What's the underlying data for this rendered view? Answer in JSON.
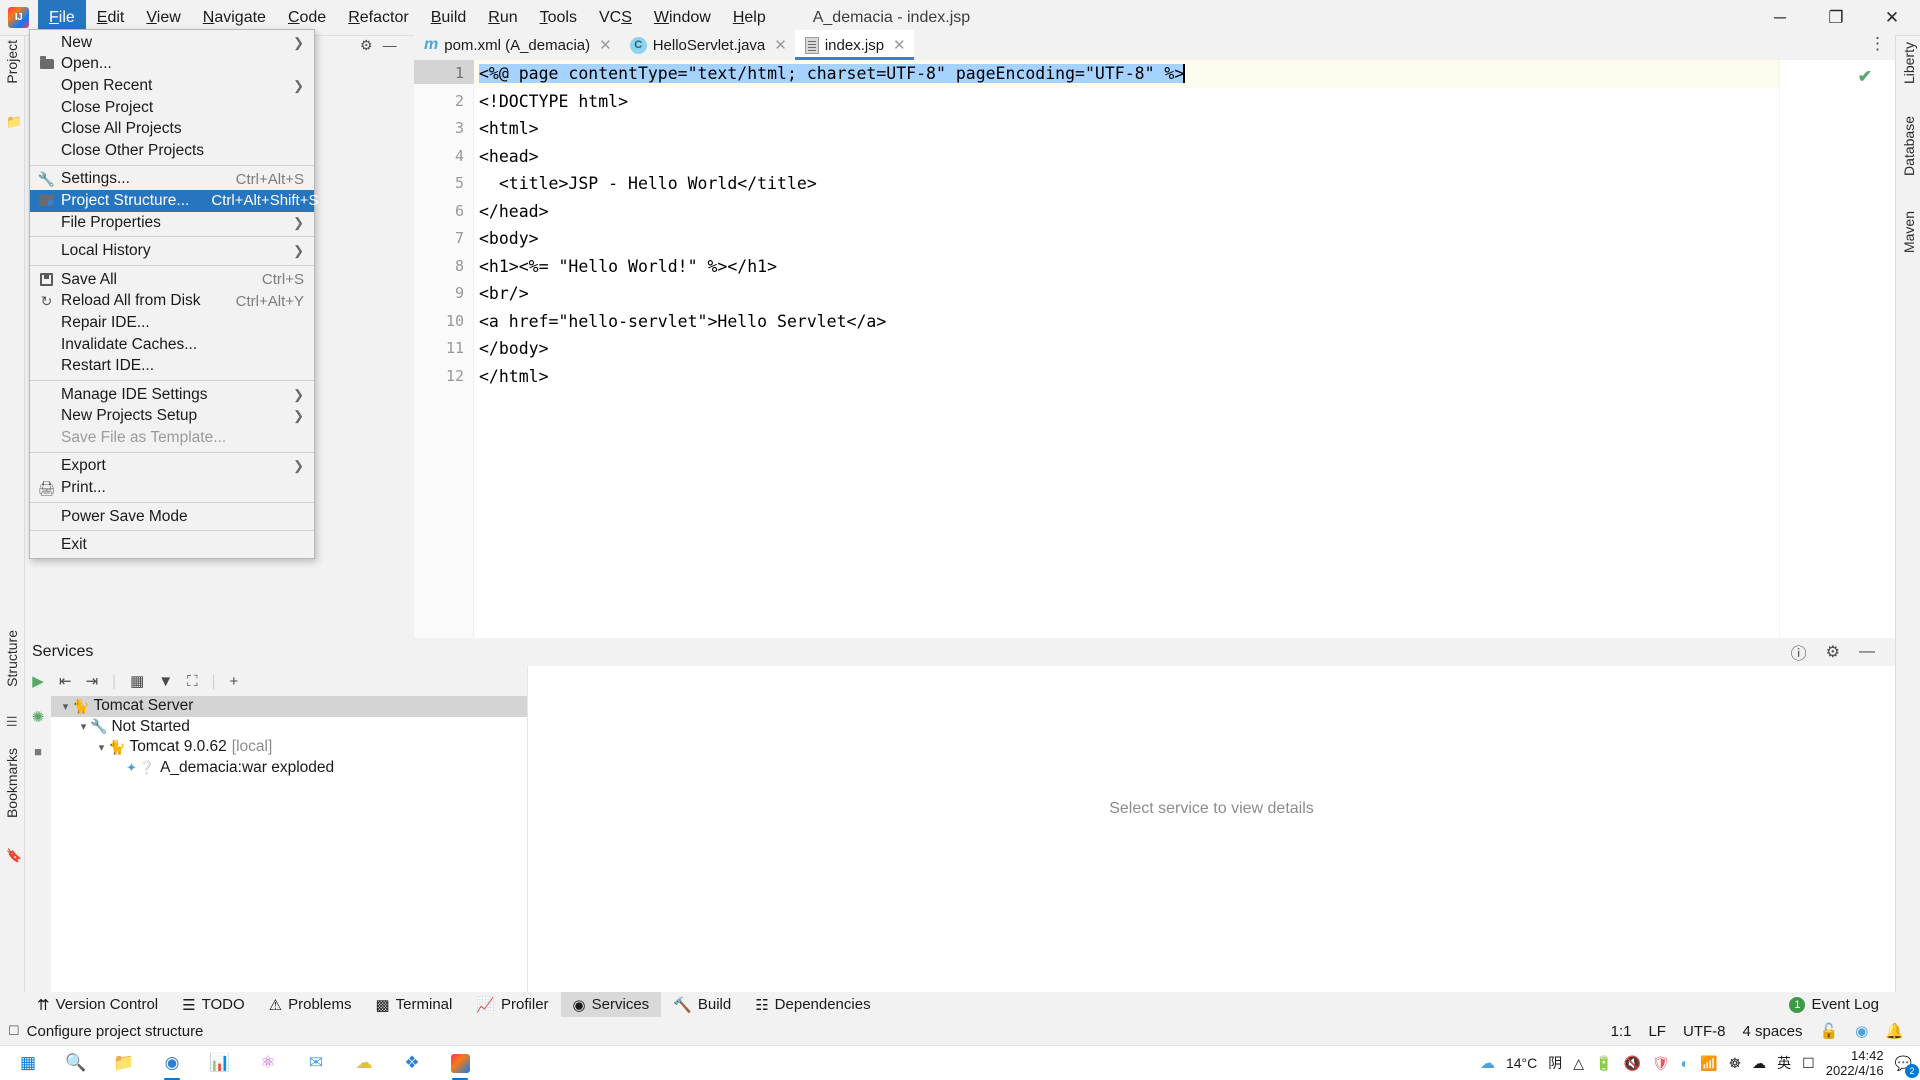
{
  "window": {
    "title": "A_demacia - index.jsp",
    "minimize": "─",
    "maximize": "❐",
    "close": "✕"
  },
  "menubar": [
    {
      "label": "File",
      "mnemonic": "F",
      "active": true
    },
    {
      "label": "Edit",
      "mnemonic": "E",
      "active": false
    },
    {
      "label": "View",
      "mnemonic": "V",
      "active": false
    },
    {
      "label": "Navigate",
      "mnemonic": "N",
      "active": false
    },
    {
      "label": "Code",
      "mnemonic": "C",
      "active": false
    },
    {
      "label": "Refactor",
      "mnemonic": "R",
      "active": false
    },
    {
      "label": "Build",
      "mnemonic": "B",
      "active": false
    },
    {
      "label": "Run",
      "mnemonic": "R",
      "active": false
    },
    {
      "label": "Tools",
      "mnemonic": "T",
      "active": false
    },
    {
      "label": "VCS",
      "mnemonic": "S",
      "active": false
    },
    {
      "label": "Window",
      "mnemonic": "W",
      "active": false
    },
    {
      "label": "Help",
      "mnemonic": "H",
      "active": false
    }
  ],
  "file_menu": {
    "items": [
      {
        "label": "New",
        "shortcut": "",
        "icon": "",
        "submenu": true,
        "selected": false,
        "disabled": false,
        "separator_after": false
      },
      {
        "label": "Open...",
        "shortcut": "",
        "icon": "folder-icon",
        "submenu": false,
        "selected": false,
        "disabled": false,
        "separator_after": false
      },
      {
        "label": "Open Recent",
        "shortcut": "",
        "icon": "",
        "submenu": true,
        "selected": false,
        "disabled": false,
        "separator_after": false
      },
      {
        "label": "Close Project",
        "shortcut": "",
        "icon": "",
        "submenu": false,
        "selected": false,
        "disabled": false,
        "separator_after": false
      },
      {
        "label": "Close All Projects",
        "shortcut": "",
        "icon": "",
        "submenu": false,
        "selected": false,
        "disabled": false,
        "separator_after": false
      },
      {
        "label": "Close Other Projects",
        "shortcut": "",
        "icon": "",
        "submenu": false,
        "selected": false,
        "disabled": false,
        "separator_after": true
      },
      {
        "label": "Settings...",
        "shortcut": "Ctrl+Alt+S",
        "icon": "wrench-icon",
        "submenu": false,
        "selected": false,
        "disabled": false,
        "separator_after": false
      },
      {
        "label": "Project Structure...",
        "shortcut": "Ctrl+Alt+Shift+S",
        "icon": "project-structure-icon",
        "submenu": false,
        "selected": true,
        "disabled": false,
        "separator_after": false
      },
      {
        "label": "File Properties",
        "shortcut": "",
        "icon": "",
        "submenu": true,
        "selected": false,
        "disabled": false,
        "separator_after": true
      },
      {
        "label": "Local History",
        "shortcut": "",
        "icon": "",
        "submenu": true,
        "selected": false,
        "disabled": false,
        "separator_after": true
      },
      {
        "label": "Save All",
        "shortcut": "Ctrl+S",
        "icon": "save-icon",
        "submenu": false,
        "selected": false,
        "disabled": false,
        "separator_after": false
      },
      {
        "label": "Reload All from Disk",
        "shortcut": "Ctrl+Alt+Y",
        "icon": "reload-icon",
        "submenu": false,
        "selected": false,
        "disabled": false,
        "separator_after": false
      },
      {
        "label": "Repair IDE...",
        "shortcut": "",
        "icon": "",
        "submenu": false,
        "selected": false,
        "disabled": false,
        "separator_after": false
      },
      {
        "label": "Invalidate Caches...",
        "shortcut": "",
        "icon": "",
        "submenu": false,
        "selected": false,
        "disabled": false,
        "separator_after": false
      },
      {
        "label": "Restart IDE...",
        "shortcut": "",
        "icon": "",
        "submenu": false,
        "selected": false,
        "disabled": false,
        "separator_after": true
      },
      {
        "label": "Manage IDE Settings",
        "shortcut": "",
        "icon": "",
        "submenu": true,
        "selected": false,
        "disabled": false,
        "separator_after": false
      },
      {
        "label": "New Projects Setup",
        "shortcut": "",
        "icon": "",
        "submenu": true,
        "selected": false,
        "disabled": false,
        "separator_after": false
      },
      {
        "label": "Save File as Template...",
        "shortcut": "",
        "icon": "",
        "submenu": false,
        "selected": false,
        "disabled": true,
        "separator_after": true
      },
      {
        "label": "Export",
        "shortcut": "",
        "icon": "",
        "submenu": true,
        "selected": false,
        "disabled": false,
        "separator_after": false
      },
      {
        "label": "Print...",
        "shortcut": "",
        "icon": "print-icon",
        "submenu": false,
        "selected": false,
        "disabled": false,
        "separator_after": true
      },
      {
        "label": "Power Save Mode",
        "shortcut": "",
        "icon": "",
        "submenu": false,
        "selected": false,
        "disabled": false,
        "separator_after": true
      },
      {
        "label": "Exit",
        "shortcut": "",
        "icon": "",
        "submenu": false,
        "selected": false,
        "disabled": false,
        "separator_after": false
      }
    ]
  },
  "left_strip": {
    "project_label": "Project",
    "structure_label": "Structure",
    "bookmarks_label": "Bookmarks"
  },
  "right_strip": {
    "liberty_label": "Liberty",
    "database_label": "Database",
    "maven_label": "Maven"
  },
  "editor_tabs": [
    {
      "label": "pom.xml (A_demacia)",
      "icon": "maven-icon",
      "active": false
    },
    {
      "label": "HelloServlet.java",
      "icon": "java-class-icon",
      "active": false
    },
    {
      "label": "index.jsp",
      "icon": "jsp-file-icon",
      "active": true
    }
  ],
  "editor": {
    "lines": [
      {
        "num": "1",
        "text": "<%@ page contentType=\"text/html; charset=UTF-8\" pageEncoding=\"UTF-8\" %>",
        "current": true
      },
      {
        "num": "2",
        "text": "<!DOCTYPE html>",
        "current": false
      },
      {
        "num": "3",
        "text": "<html>",
        "current": false
      },
      {
        "num": "4",
        "text": "<head>",
        "current": false
      },
      {
        "num": "5",
        "text": "  <title>JSP - Hello World</title>",
        "current": false
      },
      {
        "num": "6",
        "text": "</head>",
        "current": false
      },
      {
        "num": "7",
        "text": "<body>",
        "current": false
      },
      {
        "num": "8",
        "text": "<h1><%= \"Hello World!\" %></h1>",
        "current": false
      },
      {
        "num": "9",
        "text": "<br/>",
        "current": false
      },
      {
        "num": "10",
        "text": "<a href=\"hello-servlet\">Hello Servlet</a>",
        "current": false
      },
      {
        "num": "11",
        "text": "</body>",
        "current": false
      },
      {
        "num": "12",
        "text": "</html>",
        "current": false
      }
    ],
    "inspection_status": "✔"
  },
  "services": {
    "title": "Services",
    "tree": [
      {
        "label": "Tomcat Server",
        "indent": 0,
        "twisty": "⌄",
        "icon": "tomcat-icon",
        "selected": true
      },
      {
        "label": "Not Started",
        "indent": 1,
        "twisty": "⌄",
        "icon": "wrench-icon",
        "selected": false
      },
      {
        "label": "Tomcat 9.0.62",
        "suffix": "[local]",
        "indent": 2,
        "twisty": "⌄",
        "icon": "tomcat-icon",
        "selected": false
      },
      {
        "label": "A_demacia:war exploded",
        "indent": 3,
        "twisty": "",
        "icon": "artifact-icon",
        "selected": false
      }
    ],
    "detail_placeholder": "Select service to view details"
  },
  "bottom_windows": [
    {
      "label": "Version Control",
      "icon": "branch-icon",
      "active": false
    },
    {
      "label": "TODO",
      "icon": "todo-icon",
      "active": false
    },
    {
      "label": "Problems",
      "icon": "problems-icon",
      "active": false
    },
    {
      "label": "Terminal",
      "icon": "terminal-icon",
      "active": false
    },
    {
      "label": "Profiler",
      "icon": "profiler-icon",
      "active": false
    },
    {
      "label": "Services",
      "icon": "services-icon",
      "active": true
    },
    {
      "label": "Build",
      "icon": "build-icon",
      "active": false
    },
    {
      "label": "Dependencies",
      "icon": "dependencies-icon",
      "active": false
    }
  ],
  "event_log": {
    "label": "Event Log",
    "count": "1"
  },
  "statusbar": {
    "message": "Configure project structure",
    "caret_position": "1:1",
    "line_separator": "LF",
    "encoding": "UTF-8",
    "indent": "4 spaces"
  },
  "taskbar": {
    "weather_temp": "14°C",
    "weather_desc": "阴",
    "ime_lang": "英",
    "clock_time": "14:42",
    "clock_date": "2022/4/16",
    "notification_count": "2"
  }
}
